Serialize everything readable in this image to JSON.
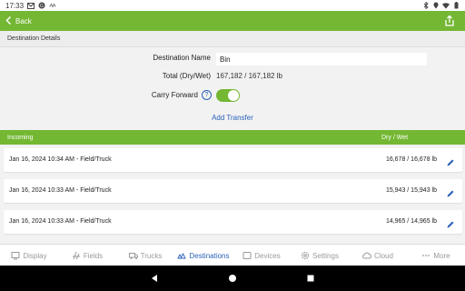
{
  "status_bar": {
    "time": "17:33",
    "icons": [
      "mail-icon",
      "g-icon",
      "app-icon"
    ]
  },
  "appbar": {
    "back_label": "Back"
  },
  "section": {
    "destination_details": "Destination Details"
  },
  "details": {
    "name_label": "Destination Name",
    "name_value": "Bin",
    "total_label": "Total (Dry/Wet)",
    "total_value": "167,182 / 167,182 lb",
    "carry_label": "Carry Forward",
    "help_text": "?",
    "carry_forward_on": true,
    "add_transfer": "Add Transfer"
  },
  "incoming": {
    "header": "Incoming",
    "dry_wet_header": "Dry / Wet",
    "rows": [
      {
        "title": "Jan 16, 2024 10:34 AM - Field/Truck",
        "amount": "16,678 / 16,678 lb"
      },
      {
        "title": "Jan 16, 2024 10:33 AM - Field/Truck",
        "amount": "15,943 / 15,943 lb"
      },
      {
        "title": "Jan 16, 2024 10:33 AM - Field/Truck",
        "amount": "14,965 / 14,965 lb"
      }
    ]
  },
  "bottom_nav": [
    {
      "label": "Display",
      "icon": "display-icon",
      "active": false
    },
    {
      "label": "Fields",
      "icon": "fields-icon",
      "active": false
    },
    {
      "label": "Trucks",
      "icon": "truck-icon",
      "active": false
    },
    {
      "label": "Destinations",
      "icon": "destinations-icon",
      "active": true
    },
    {
      "label": "Devices",
      "icon": "devices-icon",
      "active": false
    },
    {
      "label": "Settings",
      "icon": "settings-icon",
      "active": false
    },
    {
      "label": "Cloud",
      "icon": "cloud-icon",
      "active": false
    },
    {
      "label": "More",
      "icon": "more-icon",
      "active": false
    }
  ],
  "colors": {
    "brand_green": "#74b733",
    "link_blue": "#2a62b8"
  }
}
